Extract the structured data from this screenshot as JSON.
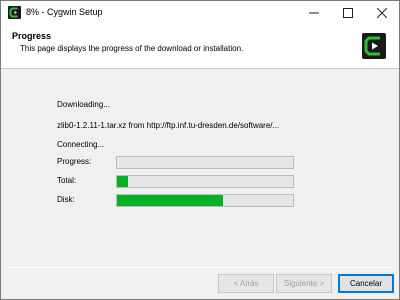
{
  "window": {
    "title": "8% - Cygwin Setup"
  },
  "header": {
    "title": "Progress",
    "subtitle": "This page displays the progress of the download or installation."
  },
  "status": {
    "action": "Downloading...",
    "file": "zlib0-1.2.11-1.tar.xz from http://ftp.inf.tu-dresden.de/software/...",
    "connection": "Connecting..."
  },
  "progress": {
    "progress_label": "Progress:",
    "progress_value": 0.0,
    "total_label": "Total:",
    "total_value": 0.06,
    "disk_label": "Disk:",
    "disk_value": 0.6
  },
  "buttons": {
    "back": "< Atrás",
    "next": "Siguiente >",
    "cancel": "Cancelar"
  },
  "icons": {
    "app": "cygwin-icon",
    "logo": "cygwin-logo-icon",
    "minimize": "minimize-icon",
    "maximize": "maximize-icon",
    "close": "close-icon"
  },
  "colors": {
    "progress_fill": "#06b025",
    "cygwin_green": "#2fbd38"
  }
}
